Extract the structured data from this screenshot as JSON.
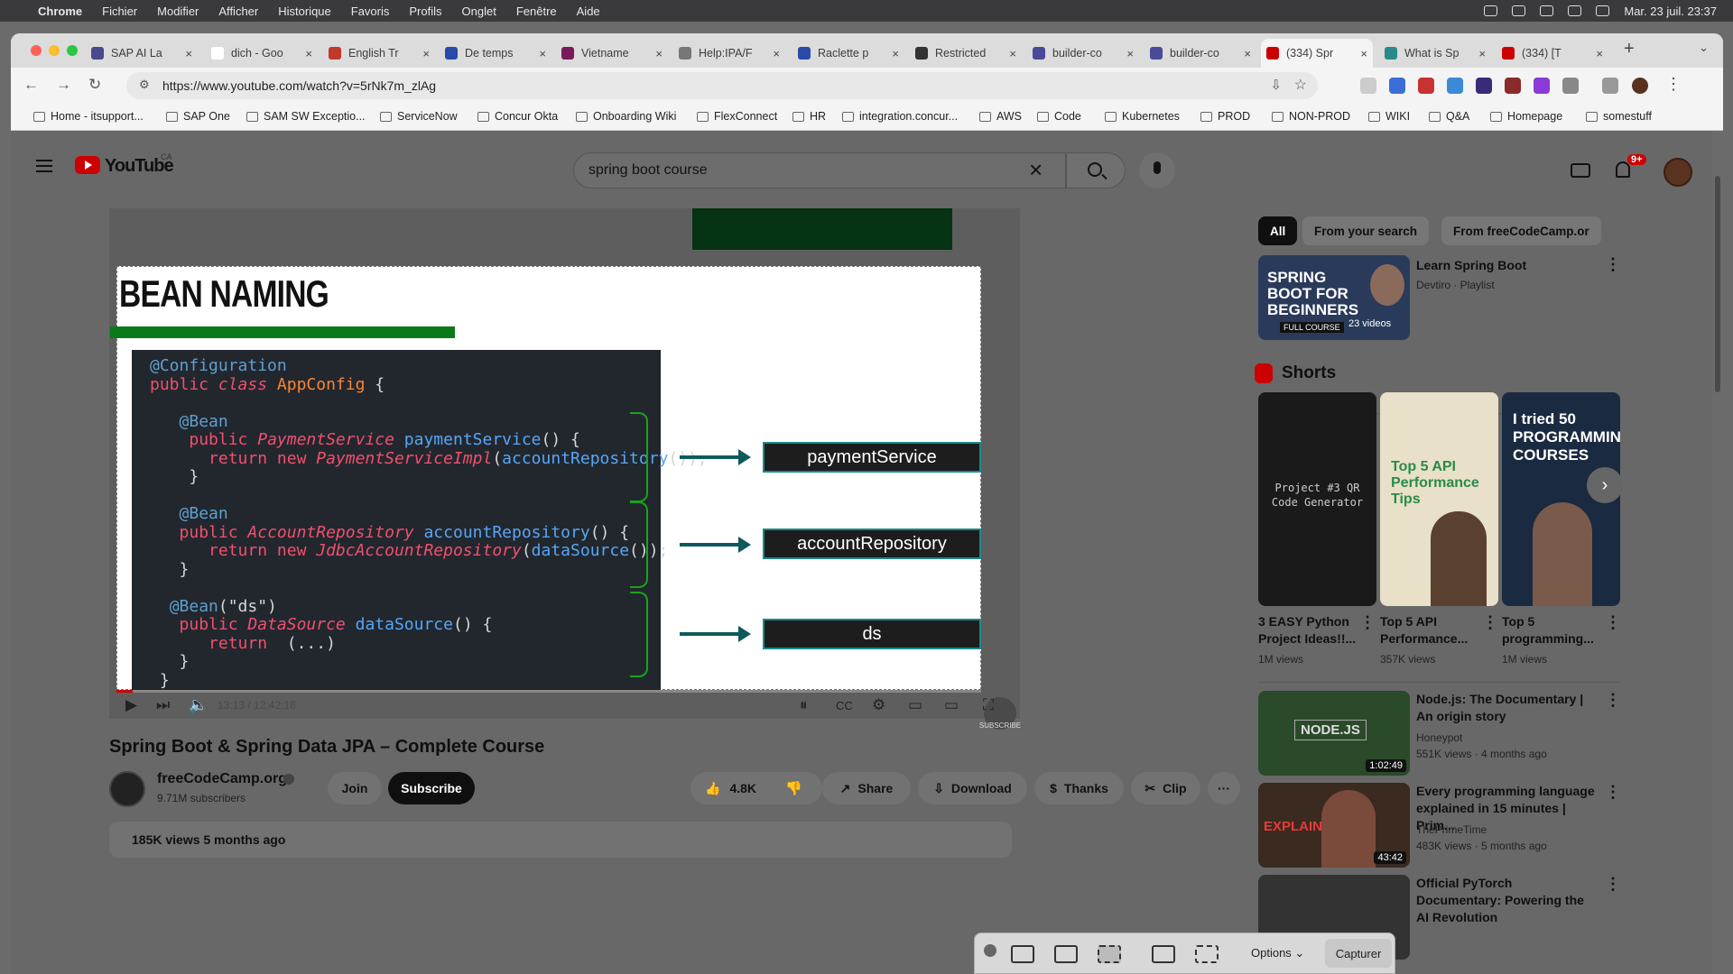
{
  "menubar": {
    "app": "Chrome",
    "items": [
      "Fichier",
      "Modifier",
      "Afficher",
      "Historique",
      "Favoris",
      "Profils",
      "Onglet",
      "Fenêtre",
      "Aide"
    ],
    "clock": "Mar. 23 juil.  23:37"
  },
  "tabs": [
    {
      "label": "SAP AI La",
      "color": "#4a4a8a"
    },
    {
      "label": "dich - Goo",
      "color": "#ffffff"
    },
    {
      "label": "English Tr",
      "color": "#c0392b"
    },
    {
      "label": "De temps",
      "color": "#2a4aa8"
    },
    {
      "label": "Vietname",
      "color": "#7a1a5a"
    },
    {
      "label": "Help:IPA/F",
      "color": "#777777"
    },
    {
      "label": "Raclette p",
      "color": "#2a4aa8"
    },
    {
      "label": "Restricted",
      "color": "#333333"
    },
    {
      "label": "builder-co",
      "color": "#4a4a9a"
    },
    {
      "label": "builder-co",
      "color": "#4a4a9a"
    },
    {
      "label": "(334) Spr",
      "color": "#cc0000"
    },
    {
      "label": "What is Sp",
      "color": "#2a8a8a"
    },
    {
      "label": "(334) [T",
      "color": "#cc0000"
    }
  ],
  "url": "https://www.youtube.com/watch?v=5rNk7m_zlAg",
  "bookmarks": [
    "Home - itsupport...",
    "SAP One",
    "SAM SW Exceptio...",
    "ServiceNow",
    "Concur Okta",
    "Onboarding Wiki",
    "FlexConnect",
    "HR",
    "integration.concur...",
    "AWS",
    "Code",
    "Kubernetes",
    "PROD",
    "NON-PROD",
    "WIKI",
    "Q&A",
    "Homepage",
    "somestuff"
  ],
  "yt": {
    "logo": "YouTube",
    "country": "CA",
    "search_value": "spring boot course",
    "notif_count": "9+"
  },
  "slide": {
    "title": "BEAN NAMING",
    "beans": [
      "paymentService",
      "accountRepository",
      "ds"
    ],
    "watermark": "SUBSCRIBE"
  },
  "player": {
    "time": "13:13 / 12:42:16"
  },
  "video": {
    "title": "Spring Boot & Spring Data JPA – Complete Course",
    "channel": "freeCodeCamp.org",
    "subs": "9.71M subscribers",
    "join": "Join",
    "subscribe": "Subscribe",
    "likes": "4.8K",
    "share": "Share",
    "download": "Download",
    "thanks": "Thanks",
    "clip": "Clip",
    "meta": "185K views  5 months ago"
  },
  "chips": [
    "All",
    "From your search",
    "From freeCodeCamp.or"
  ],
  "playlist": {
    "title": "Learn Spring Boot",
    "sub": "Devtiro · Playlist",
    "thumb_text": "SPRING BOOT FOR BEGINNERS",
    "badge": "FULL COURSE",
    "count": "23 videos"
  },
  "shorts_label": "Shorts",
  "shorts": [
    {
      "title": "3 EASY Python Project Ideas!!...",
      "views": "1M views",
      "thumb": "Project #3 QR Code Generator",
      "bg": "#1a1a1a"
    },
    {
      "title": "Top 5 API Performance...",
      "views": "357K views",
      "thumb": "Top 5 API Performance Tips",
      "bg": "#e8e0c8"
    },
    {
      "title": "Top 5 programming...",
      "views": "1M views",
      "thumb": "I tried 50 PROGRAMMING COURSES",
      "bg": "#1a2a40"
    }
  ],
  "related": [
    {
      "title": "Node.js: The Documentary | An origin story",
      "channel": "Honeypot",
      "meta": "551K views · 4 months ago",
      "duration": "1:02:49",
      "thumb": "NODE.JS",
      "bg": "#2a4a2a"
    },
    {
      "title": "Every programming language explained in 15 minutes | Prim...",
      "channel": "ThePrimeTime",
      "meta": "483K views · 5 months ago",
      "duration": "43:42",
      "thumb": "EXPLAINED",
      "bg": "#3a2a20"
    },
    {
      "title": "Official PyTorch Documentary: Powering the AI Revolution",
      "channel": "",
      "meta": "",
      "duration": "",
      "thumb": "",
      "bg": "#333"
    }
  ],
  "capture": {
    "options": "Options",
    "capture": "Capturer"
  }
}
